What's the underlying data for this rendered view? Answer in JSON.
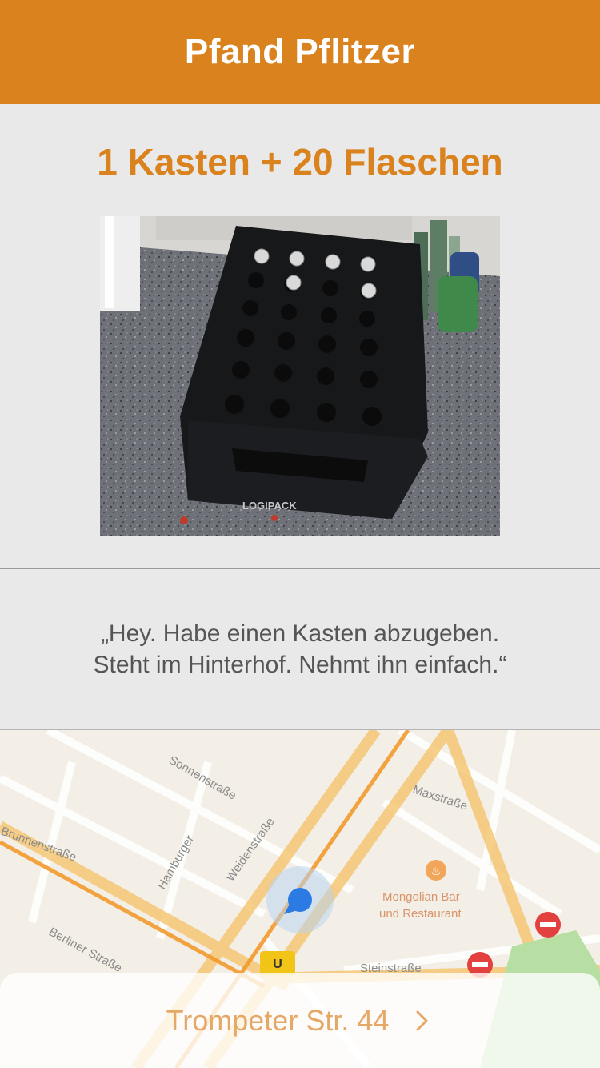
{
  "app": {
    "title": "Pfand Pflitzer"
  },
  "item": {
    "title": "1 Kasten + 20 Flaschen"
  },
  "photo": {
    "crate_brand": "LOGIPACK"
  },
  "message": {
    "text": "„Hey. Habe einen Kasten abzugeben. Steht im Hinterhof. Nehmt ihn einfach.“"
  },
  "map": {
    "streets": [
      "Sonnenstraße",
      "Maxstraße",
      "Berliner Straße",
      "Weidenstraße",
      "Hamburger",
      "Brunnenstraße",
      "Steinstraße"
    ],
    "poi": {
      "name_line1": "Mongolian Bar",
      "name_line2": "und Restaurant"
    },
    "badge": "U"
  },
  "address": {
    "label": "Trompeter Str. 44"
  },
  "colors": {
    "accent": "#d9821e",
    "address_text": "#e6a866"
  }
}
